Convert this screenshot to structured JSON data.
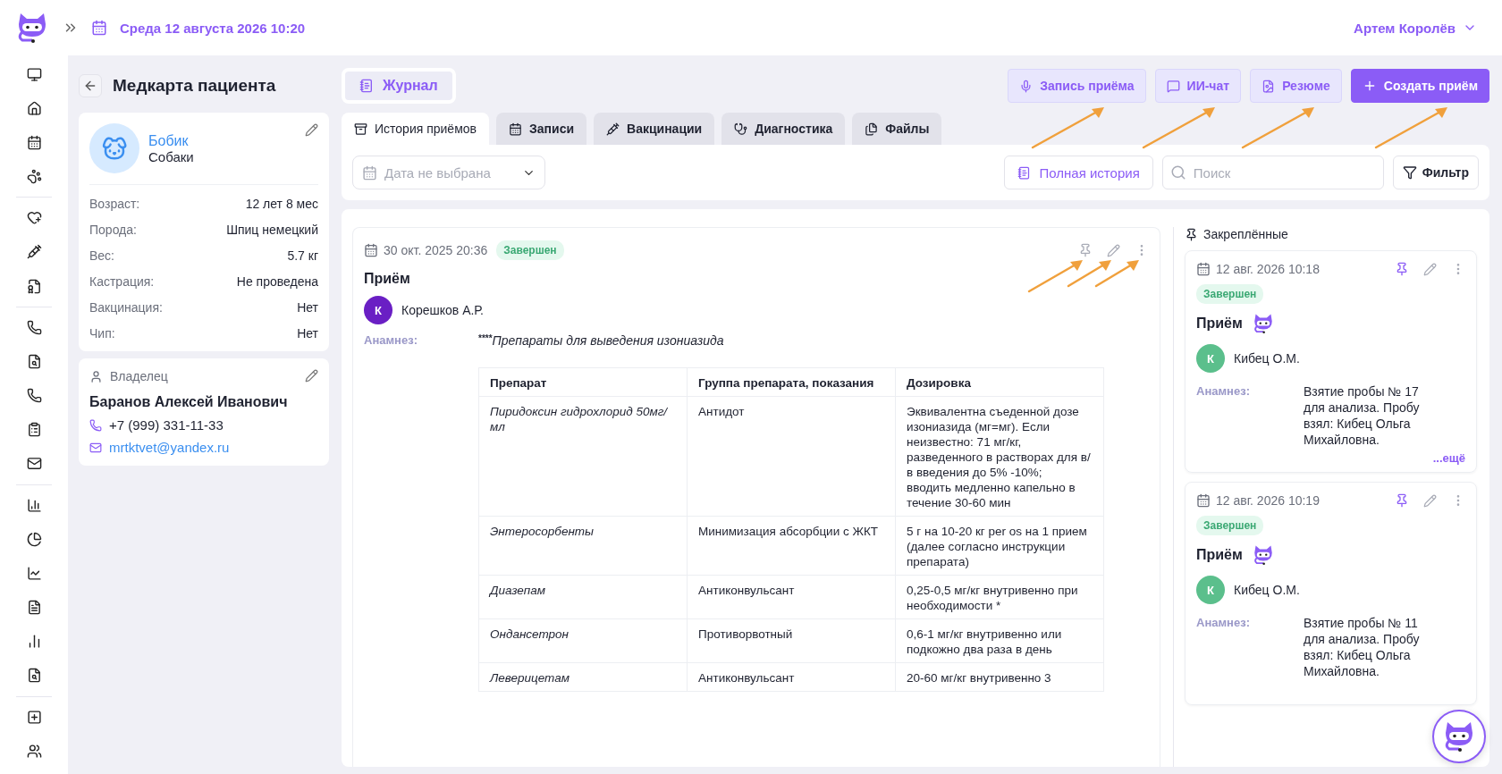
{
  "header": {
    "date": "Среда 12 августа 2026 10:20",
    "user": "Артем Королёв"
  },
  "page": {
    "title": "Медкарта пациента"
  },
  "patient": {
    "name": "Бобик",
    "species": "Собаки",
    "fields": [
      {
        "label": "Возраст:",
        "value": "12 лет 8 мес"
      },
      {
        "label": "Порода:",
        "value": "Шпиц немецкий"
      },
      {
        "label": "Вес:",
        "value": "5.7 кг"
      },
      {
        "label": "Кастрация:",
        "value": "Не проведена"
      },
      {
        "label": "Вакцинация:",
        "value": "Нет"
      },
      {
        "label": "Чип:",
        "value": "Нет"
      }
    ]
  },
  "owner": {
    "heading": "Владелец",
    "name": "Баранов Алексей Иванович",
    "phone": "+7 (999) 331-11-33",
    "email": "mrtktvet@yandex.ru"
  },
  "journal_button": "Журнал",
  "actions": [
    {
      "label": "Запись приёма",
      "kind": "record",
      "pointed": true
    },
    {
      "label": "ИИ-чат",
      "kind": "chat",
      "pointed": true
    },
    {
      "label": "Резюме",
      "kind": "summary",
      "pointed": true
    },
    {
      "label": "Создать приём",
      "kind": "primary",
      "pointed": true
    }
  ],
  "tabs": [
    {
      "label": "История приёмов",
      "kind": "history",
      "selected": true
    },
    {
      "label": "Записи",
      "kind": "appointments",
      "selected": false
    },
    {
      "label": "Вакцинации",
      "kind": "vaccines",
      "selected": false
    },
    {
      "label": "Диагностика",
      "kind": "diagnostics",
      "selected": false
    },
    {
      "label": "Файлы",
      "kind": "files",
      "selected": false
    }
  ],
  "filters": {
    "date_placeholder": "Дата не выбрана",
    "history_button": "Полная история",
    "search_placeholder": "Поиск",
    "filter_button": "Фильтр"
  },
  "record": {
    "date": "30 окт. 2025 20:36",
    "status": "Завершен",
    "title": "Приём",
    "doctor_initial": "К",
    "doctor": "Корешков А.Р.",
    "anamnesis_label": "Анамнез:",
    "anamnesis_mark": "****",
    "anamnesis": "Препараты для выведения изониазида",
    "pinned": false,
    "actions_pointed": true,
    "table": {
      "columns": [
        "Препарат",
        "Группа препарата, показания",
        "Дозировка"
      ],
      "rows": [
        [
          "Пиридоксин гидрохлорид 50мг/мл",
          "Антидот",
          "Эквивалентна съеденной дозе изониазида (мг=мг). Если неизвестно: 71 мг/кг, разведенного в растворах для в/в введения до 5% -10%;\nвводить медленно капельно в течение 30-60 мин"
        ],
        [
          "Энтеросорбенты",
          "Минимизация абсорбции с ЖКТ",
          "5 г на 10-20 кг per os на 1 прием (далее согласно инструкции препарата)"
        ],
        [
          "Диазепам",
          "Антиконвульсант",
          "0,25-0,5 мг/кг внутривенно при необходимости *"
        ],
        [
          "Ондансетрон",
          "Противорвотный",
          "0,6-1 мг/кг внутривенно или подкожно два раза в день"
        ],
        [
          "Леверицетам",
          "Антиконвульсант",
          "20-60 мг/кг внутривенно 3"
        ]
      ]
    }
  },
  "pinned": {
    "heading": "Закреплённые",
    "cards": [
      {
        "date": "12 авг. 2026 10:18",
        "status": "Завершен",
        "title": "Приём",
        "doctor_initial": "К",
        "doctor": "Кибец О.М.",
        "anamnesis_label": "Анамнез:",
        "anamnesis": "Взятие пробы № 17 для анализа. Пробу взял: Кибец Ольга Михайловна.",
        "more": "...ещё",
        "pinned": true
      },
      {
        "date": "12 авг. 2026 10:19",
        "status": "Завершен",
        "title": "Приём",
        "doctor_initial": "К",
        "doctor": "Кибец О.М.",
        "anamnesis_label": "Анамнез:",
        "anamnesis": "Взятие пробы № 11 для анализа. Пробу взял: Кибец Ольга Михайловна.",
        "pinned": true
      }
    ]
  }
}
